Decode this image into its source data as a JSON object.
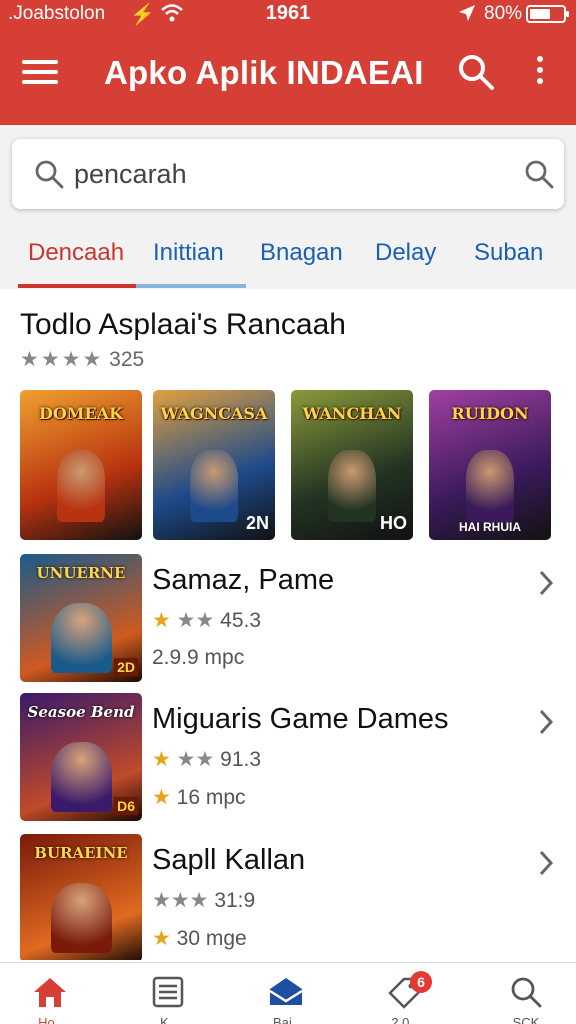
{
  "status_bar": {
    "carrier": ".Joabstolon",
    "time": "1961",
    "battery": "80%"
  },
  "app_bar": {
    "title": "Apko Aplik INDAEAI",
    "background_color": "#d63f35"
  },
  "search": {
    "value": "pencarah"
  },
  "tabs": [
    {
      "label": "Dencaah",
      "active": true
    },
    {
      "label": "Inittian",
      "active": false
    },
    {
      "label": "Bnagan",
      "active": false
    },
    {
      "label": "Delay",
      "active": false
    },
    {
      "label": "Suban",
      "active": false
    }
  ],
  "section": {
    "title": "Todlo Asplaai's Rancaah",
    "rating_stars": "★★★★",
    "rating_count": "325"
  },
  "cards": [
    {
      "title": "DOMEAK",
      "foot": "",
      "colors": [
        "#b8330f",
        "#f0a030"
      ]
    },
    {
      "title": "WAGNCASA",
      "foot": "2N",
      "colors": [
        "#1d4a8a",
        "#e0a040"
      ]
    },
    {
      "title": "WANCHAN",
      "foot": "HO",
      "colors": [
        "#223322",
        "#8a9a3a"
      ]
    },
    {
      "title": "RUIDON",
      "foot": "HAI RHUIA",
      "colors": [
        "#3a1a5a",
        "#a040a0"
      ]
    }
  ],
  "list": [
    {
      "name": "Samaz, Pame",
      "rating_star": "★",
      "rating_rest": "★★",
      "rating_value": "45.3",
      "size_star": "",
      "size": "2.9.9 mpc",
      "thumb_title": "UNUERNE",
      "thumb_badge": "2D",
      "colors": [
        "#1a5a8a",
        "#d05a20"
      ]
    },
    {
      "name": "Miguaris Game Dames",
      "rating_star": "★",
      "rating_rest": "★★",
      "rating_value": "91.3",
      "size_star": "★",
      "size": "16 mpc",
      "thumb_title": "Seasoe Bend",
      "thumb_badge": "D6",
      "colors": [
        "#3a1a6a",
        "#c04a2a"
      ]
    },
    {
      "name": "Sapll Kallan",
      "rating_star": "",
      "rating_rest": "★★★",
      "rating_value": "31:9",
      "size_star": "★",
      "size": "30 mge",
      "thumb_title": "BURAEINE",
      "thumb_badge": "",
      "colors": [
        "#7a1a0a",
        "#e06a20"
      ]
    }
  ],
  "bottom_nav": [
    {
      "icon": "home-icon",
      "label": "Ho..",
      "active": true
    },
    {
      "icon": "list-icon",
      "label": "K..",
      "active": false
    },
    {
      "icon": "inbox-icon",
      "label": "Bai..",
      "active": false
    },
    {
      "icon": "tag-icon",
      "label": "2.0..",
      "badge": "6",
      "active": false
    },
    {
      "icon": "search-icon",
      "label": "SCK",
      "active": false
    }
  ]
}
